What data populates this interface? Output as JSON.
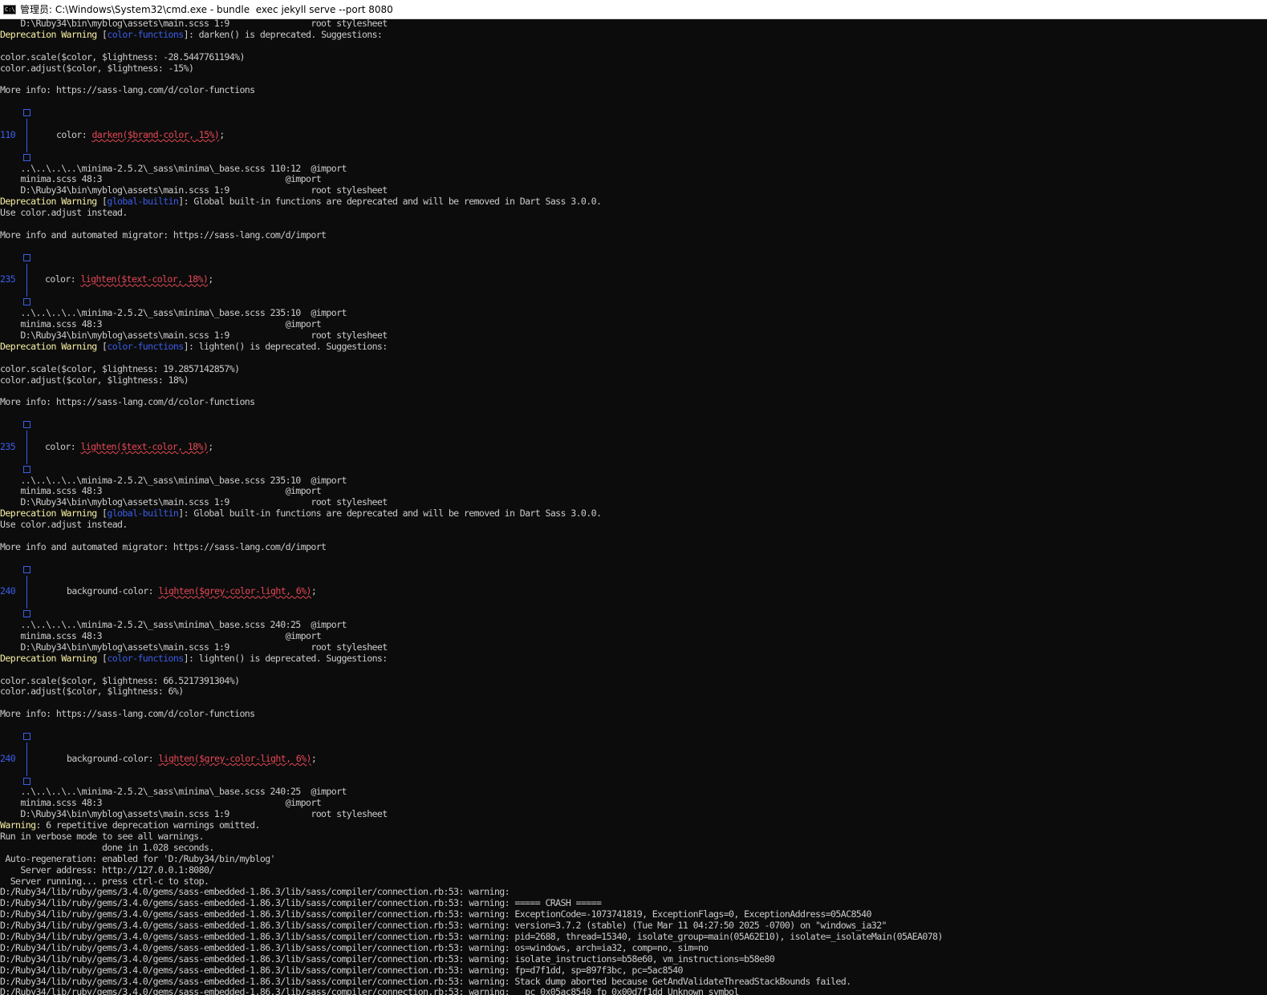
{
  "window": {
    "title": "管理员: C:\\Windows\\System32\\cmd.exe - bundle  exec jekyll serve --port 8080",
    "icon": "cmd-icon"
  },
  "console": {
    "l01": "    D:\\Ruby34\\bin\\myblog\\assets\\main.scss 1:9                root stylesheet",
    "dep_label": "Deprecation Warning",
    "tag_color": "color-functions",
    "tag_global": "global-builtin",
    "msg_darken": "]: darken() is deprecated. Suggestions:",
    "msg_lighten": "]: lighten() is deprecated. Suggestions:",
    "msg_global": "]: Global built-in functions are deprecated and will be removed in Dart Sass 3.0.0.",
    "open_bracket": " [",
    "scale_1": "color.scale($color, $lightness: -28.5447761194%)",
    "adjust_1": "color.adjust($color, $lightness: -15%)",
    "more_info_color": "More info: https://sass-lang.com/d/color-functions",
    "use_adjust": "Use color.adjust instead.",
    "more_info_import": "More info and automated migrator: https://sass-lang.com/d/import",
    "ln_110": "110",
    "ln_235": "235",
    "ln_240": "240",
    "code_110_prop": "color: ",
    "code_110_expr": "darken($brand-color, 15%)",
    "code_235_prop": "color: ",
    "code_235_expr": "lighten($text-color, 18%)",
    "code_240_prop": "background-color: ",
    "code_240_expr": "lighten($grey-color-light, 6%)",
    "semi": ";",
    "trace_110": "    ..\\..\\..\\..\\minima-2.5.2\\_sass\\minima\\_base.scss 110:12  @import",
    "trace_235": "    ..\\..\\..\\..\\minima-2.5.2\\_sass\\minima\\_base.scss 235:10  @import",
    "trace_240": "    ..\\..\\..\\..\\minima-2.5.2\\_sass\\minima\\_base.scss 240:25  @import",
    "trace_minima": "    minima.scss 48:3                                    @import",
    "trace_main": "    D:\\Ruby34\\bin\\myblog\\assets\\main.scss 1:9                root stylesheet",
    "scale_2": "color.scale($color, $lightness: 19.2857142857%)",
    "adjust_2": "color.adjust($color, $lightness: 18%)",
    "scale_3": "color.scale($color, $lightness: 66.5217391304%)",
    "adjust_3": "color.adjust($color, $lightness: 6%)",
    "warning_label": "Warning",
    "warning_msg": ": 6 repetitive deprecation warnings omitted.",
    "verbose": "Run in verbose mode to see all warnings.",
    "done": "                    done in 1.028 seconds.",
    "autoregen": " Auto-regeneration: enabled for 'D:/Ruby34/bin/myblog'",
    "server_addr": "    Server address: http://127.0.0.1:8080/",
    "server_running": "  Server running... press ctrl-c to stop.",
    "crash_prefix": "D:/Ruby34/lib/ruby/gems/3.4.0/gems/sass-embedded-1.86.3/lib/sass/compiler/connection.rb:53: warning: ",
    "crash_lines": [
      "",
      "===== CRASH =====",
      "ExceptionCode=-1073741819, ExceptionFlags=0, ExceptionAddress=05AC8540",
      "version=3.7.2 (stable) (Tue Mar 11 04:27:50 2025 -0700) on \"windows_ia32\"",
      "pid=2688, thread=15340, isolate_group=main(05A62E10), isolate=_isolateMain(05AEA078)",
      "os=windows, arch=ia32, comp=no, sim=no",
      "isolate_instructions=b58e60, vm_instructions=b58e80",
      "fp=d7f1dd, sp=897f3bc, pc=5ac8540",
      "Stack dump aborted because GetAndValidateThreadStackBounds failed.",
      "  pc 0x05ac8540 fp 0x00d7f1dd Unknown symbol"
    ]
  }
}
